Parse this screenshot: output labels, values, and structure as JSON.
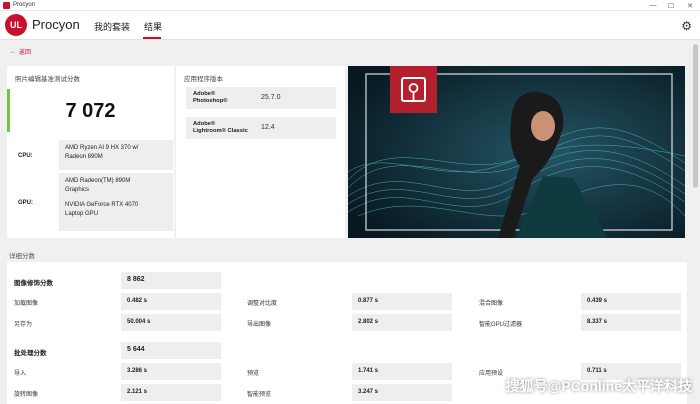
{
  "window": {
    "title": "Procyon",
    "minimize": "—",
    "maximize": "☐",
    "close": "✕"
  },
  "header": {
    "logo": "UL",
    "brand": "Procyon",
    "tabs": [
      "我的套装",
      "结果"
    ]
  },
  "back": {
    "label": "返回"
  },
  "score_card": {
    "title": "照片编辑基准测试分数",
    "score": "7 072",
    "cpu_label": "CPU:",
    "cpu": [
      "AMD Ryzen AI 9 HX 370 w/",
      "Radeon 890M"
    ],
    "gpu_label": "GPU:",
    "gpu": [
      "AMD Radeon(TM) 890M",
      "Graphics",
      "",
      "NVIDIA GeForce RTX 4070",
      "Laptop GPU"
    ]
  },
  "versions": {
    "title": "应用程序版本",
    "items": [
      {
        "name": [
          "Adobe®",
          "Photoshop®"
        ],
        "version": "25.7.0"
      },
      {
        "name": [
          "Adobe®",
          "Lightroom® Classic"
        ],
        "version": "12.4"
      }
    ]
  },
  "details": {
    "title": "详细分数",
    "groups": [
      {
        "label": "图像修饰分数",
        "value": "8 862",
        "metrics": [
          {
            "label": "加载图像",
            "value": "0.482 s"
          },
          {
            "label": "调整对比度",
            "value": "0.877 s"
          },
          {
            "label": "混合图像",
            "value": "0.439 s"
          },
          {
            "label": "另存为",
            "value": "50.004 s"
          },
          {
            "label": "导出图像",
            "value": "2.802 s"
          },
          {
            "label": "智能GPU过滤器",
            "value": "8.337 s"
          }
        ]
      },
      {
        "label": "批处理分数",
        "value": "5 644",
        "metrics": [
          {
            "label": "导入",
            "value": "3.286 s"
          },
          {
            "label": "预览",
            "value": "1.741 s"
          },
          {
            "label": "应用预设",
            "value": "0.711 s"
          },
          {
            "label": "旋转图像",
            "value": "2.121 s"
          },
          {
            "label": "智能预览",
            "value": "3.247 s"
          }
        ]
      }
    ]
  },
  "watermark": "搜狐号@PConline太平洋科技",
  "colors": {
    "accent": "#c8102e",
    "score_bar": "#7ac143"
  }
}
